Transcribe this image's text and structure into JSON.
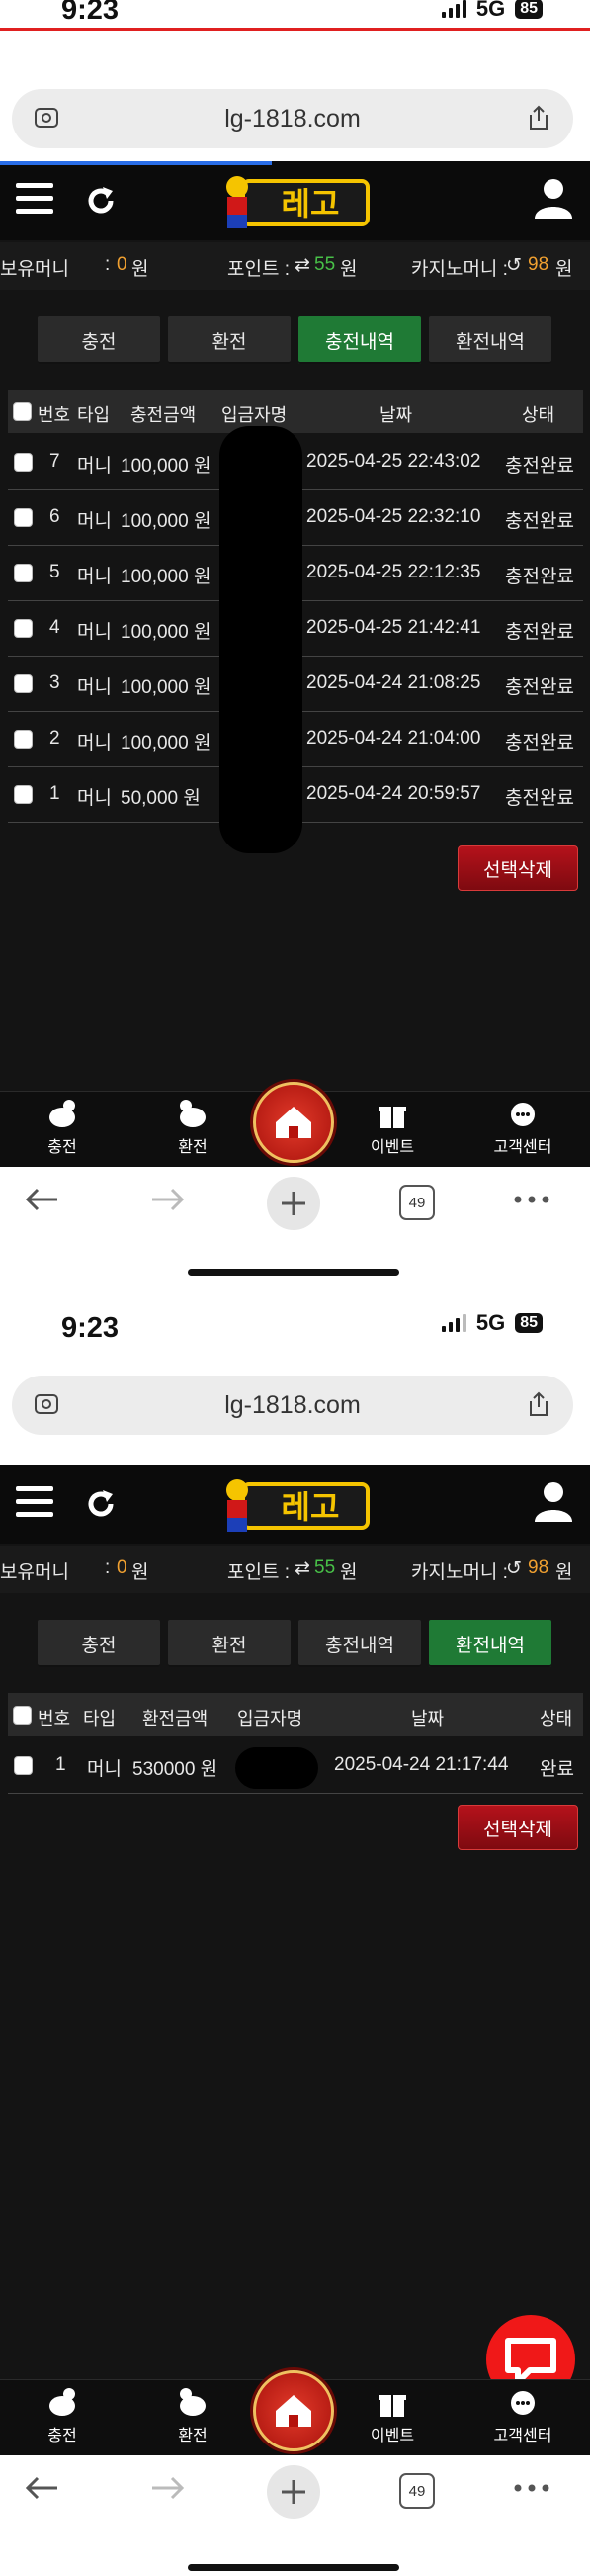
{
  "status": {
    "time": "9:23",
    "network": "5G",
    "battery": "85"
  },
  "browser": {
    "url": "lg-1818.com",
    "tab_count": "49"
  },
  "app": {
    "logo_text": "레고"
  },
  "info": {
    "money_label": "보유머니",
    "money_sep": ":",
    "money_value": "0",
    "money_unit": "원",
    "point_label": "포인트 :",
    "point_value": "55",
    "point_unit": "원",
    "casino_label": "카지노머니 :",
    "casino_value": "98",
    "casino_unit": "원"
  },
  "tabs": [
    "충전",
    "환전",
    "충전내역",
    "환전내역"
  ],
  "deposit_history": {
    "active_tab": 2,
    "headers": [
      "번호",
      "타입",
      "충전금액",
      "입금자명",
      "날짜",
      "상태"
    ],
    "rows": [
      {
        "no": "7",
        "type": "머니",
        "amount": "100,000 원",
        "date": "2025-04-25 22:43:02",
        "status": "충전완료"
      },
      {
        "no": "6",
        "type": "머니",
        "amount": "100,000 원",
        "date": "2025-04-25 22:32:10",
        "status": "충전완료"
      },
      {
        "no": "5",
        "type": "머니",
        "amount": "100,000 원",
        "date": "2025-04-25 22:12:35",
        "status": "충전완료"
      },
      {
        "no": "4",
        "type": "머니",
        "amount": "100,000 원",
        "date": "2025-04-25 21:42:41",
        "status": "충전완료"
      },
      {
        "no": "3",
        "type": "머니",
        "amount": "100,000 원",
        "date": "2025-04-24 21:08:25",
        "status": "충전완료"
      },
      {
        "no": "2",
        "type": "머니",
        "amount": "100,000 원",
        "date": "2025-04-24 21:04:00",
        "status": "충전완료"
      },
      {
        "no": "1",
        "type": "머니",
        "amount": "50,000 원",
        "date": "2025-04-24 20:59:57",
        "status": "충전완료"
      }
    ],
    "delete_label": "선택삭제"
  },
  "withdraw_history": {
    "active_tab": 3,
    "headers": [
      "번호",
      "타입",
      "환전금액",
      "입금자명",
      "날짜",
      "상태"
    ],
    "rows": [
      {
        "no": "1",
        "type": "머니",
        "amount": "530000 원",
        "date": "2025-04-24 21:17:44",
        "status": "완료"
      }
    ],
    "delete_label": "선택삭제"
  },
  "bottom_nav": [
    "충전",
    "환전",
    "이벤트",
    "고객센터"
  ],
  "colors": {
    "accent_green": "#1f7a35",
    "delete_red": "#9a0e14",
    "bg": "#141414",
    "money_orange": "#f0a030",
    "point_green": "#48c048"
  }
}
